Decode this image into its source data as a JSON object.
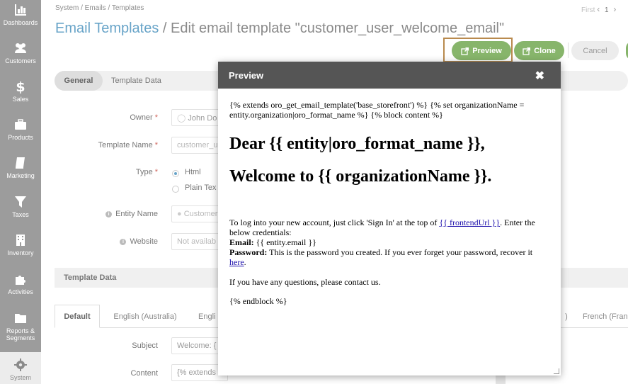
{
  "sidebar": {
    "items": [
      {
        "label": "Dashboards",
        "icon": "chart-icon"
      },
      {
        "label": "Customers",
        "icon": "users-icon"
      },
      {
        "label": "Sales",
        "icon": "dollar-icon"
      },
      {
        "label": "Products",
        "icon": "briefcase-icon"
      },
      {
        "label": "Marketing",
        "icon": "book-icon"
      },
      {
        "label": "Taxes",
        "icon": "filter-icon"
      },
      {
        "label": "Inventory",
        "icon": "building-icon"
      },
      {
        "label": "Activities",
        "icon": "puzzle-icon"
      },
      {
        "label": "Reports & Segments",
        "icon": "folder-icon"
      },
      {
        "label": "System",
        "icon": "gear-icon"
      }
    ]
  },
  "breadcrumb": "System / Emails / Templates",
  "title": {
    "root": "Email Templates",
    "separator": " / ",
    "current": "Edit email template \"customer_user_welcome_email\""
  },
  "pager": {
    "first": "First",
    "page": "1"
  },
  "actions": {
    "preview": "Preview",
    "clone": "Clone",
    "cancel": "Cancel"
  },
  "sections": {
    "general": "General",
    "template_data": "Template Data"
  },
  "form": {
    "owner_label": "Owner",
    "owner_value": "John Do",
    "template_name_label": "Template Name",
    "template_name_value": "customer_u",
    "type_label": "Type",
    "type_html": "Html",
    "type_plain": "Plain Tex",
    "entity_name_label": "Entity Name",
    "entity_name_value": "Customer",
    "website_label": "Website",
    "website_value": "Not availab"
  },
  "template_data_header": "Template Data",
  "lang_tabs": [
    "Default",
    "English (Australia)",
    "Engli",
    ")",
    "French (Fran"
  ],
  "subject_label": "Subject",
  "subject_value": "Welcome: {",
  "content_label": "Content",
  "content_value": "{% extends",
  "modal": {
    "title": "Preview",
    "close": "✖",
    "code_line": "{% extends oro_get_email_template('base_storefront') %} {% set organizationName = entity.organization|oro_format_name %} {% block content %}",
    "heading1": "Dear {{ entity|oro_format_name }},",
    "heading2": "Welcome to {{ organizationName }}.",
    "login_text_pre": "To log into your new account, just click 'Sign In' at the top of ",
    "login_link": "{{ frontendUrl }}",
    "login_text_post": ". Enter the below credentials:",
    "email_label": "Email:",
    "email_value": " {{ entity.email }}",
    "password_label": "Password:",
    "password_text": " This is the password you created. If you ever forget your password, recover it ",
    "password_link": "here",
    "password_end": ".",
    "questions": "If you have any questions, please contact us.",
    "endblock": "{% endblock %}"
  },
  "colors": {
    "sidebar": "#9c9c9c",
    "accent_blue": "#68a4c8",
    "button_green": "#87b56b",
    "modal_header": "#555555",
    "highlight": "#b98a4e"
  }
}
